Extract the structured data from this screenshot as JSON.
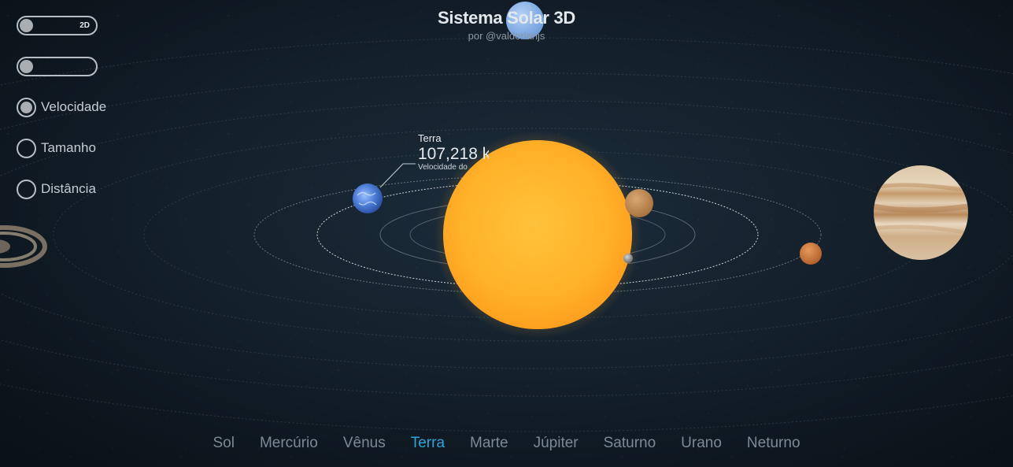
{
  "header": {
    "title": "Sistema Solar 3D",
    "subtitle": "por @valderlanjs"
  },
  "controls": {
    "view_toggle_label": "2D",
    "radio_options": [
      {
        "label": "Velocidade",
        "selected": true
      },
      {
        "label": "Tamanho",
        "selected": false
      },
      {
        "label": "Distância",
        "selected": false
      }
    ]
  },
  "tooltip": {
    "planet_name": "Terra",
    "speed_value": "107,218 k",
    "speed_label": "Velocidade do"
  },
  "nav": {
    "items": [
      "Sol",
      "Mercúrio",
      "Vênus",
      "Terra",
      "Marte",
      "Júpiter",
      "Saturno",
      "Urano",
      "Neturno"
    ],
    "active_index": 3
  },
  "colors": {
    "accent": "#2aa6da",
    "sun": "#ffb52e",
    "earth": "#4d7fd6",
    "mars": "#cf7a3f",
    "venus": "#c8945c",
    "jupiter": "#d9bc97",
    "mercury": "#9a9a9a",
    "uranus": "#8bb6e8"
  }
}
